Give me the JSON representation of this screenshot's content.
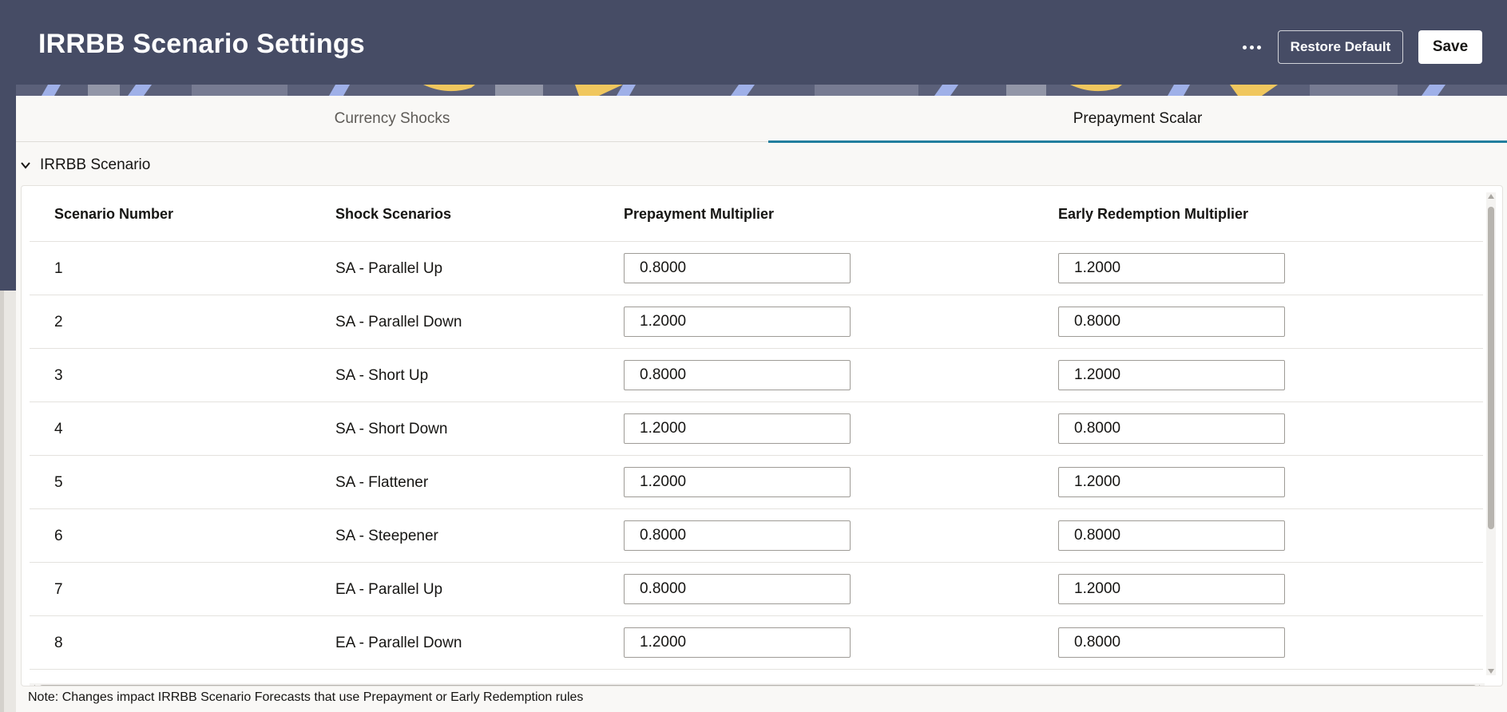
{
  "header": {
    "title": "IRRBB Scenario Settings",
    "more_icon": "ellipsis-icon",
    "restore_label": "Restore Default",
    "save_label": "Save"
  },
  "tabs": [
    {
      "label": "Currency Shocks",
      "active": false
    },
    {
      "label": "Prepayment Scalar",
      "active": true
    }
  ],
  "section": {
    "title": "IRRBB Scenario",
    "icon": "chevron-down-icon",
    "expanded": true
  },
  "table": {
    "headers": [
      "Scenario Number",
      "Shock Scenarios",
      "Prepayment Multiplier",
      "Early Redemption Multiplier"
    ],
    "rows": [
      {
        "number": "1",
        "scenario": "SA - Parallel Up",
        "prepayment": "0.8000",
        "early_redemption": "1.2000"
      },
      {
        "number": "2",
        "scenario": "SA - Parallel Down",
        "prepayment": "1.2000",
        "early_redemption": "0.8000"
      },
      {
        "number": "3",
        "scenario": "SA - Short Up",
        "prepayment": "0.8000",
        "early_redemption": "1.2000"
      },
      {
        "number": "4",
        "scenario": "SA - Short Down",
        "prepayment": "1.2000",
        "early_redemption": "0.8000"
      },
      {
        "number": "5",
        "scenario": "SA - Flattener",
        "prepayment": "1.2000",
        "early_redemption": "1.2000"
      },
      {
        "number": "6",
        "scenario": "SA - Steepener",
        "prepayment": "0.8000",
        "early_redemption": "0.8000"
      },
      {
        "number": "7",
        "scenario": "EA - Parallel Up",
        "prepayment": "0.8000",
        "early_redemption": "1.2000"
      },
      {
        "number": "8",
        "scenario": "EA - Parallel Down",
        "prepayment": "1.2000",
        "early_redemption": "0.8000"
      }
    ]
  },
  "note": "Note: Changes impact IRRBB Scenario Forecasts that use Prepayment or Early Redemption rules",
  "colors": {
    "header_bg": "#464c65",
    "tab_accent": "#227e9e",
    "pattern_yellow": "#f0c75e",
    "pattern_blue": "#9fb0e8"
  }
}
